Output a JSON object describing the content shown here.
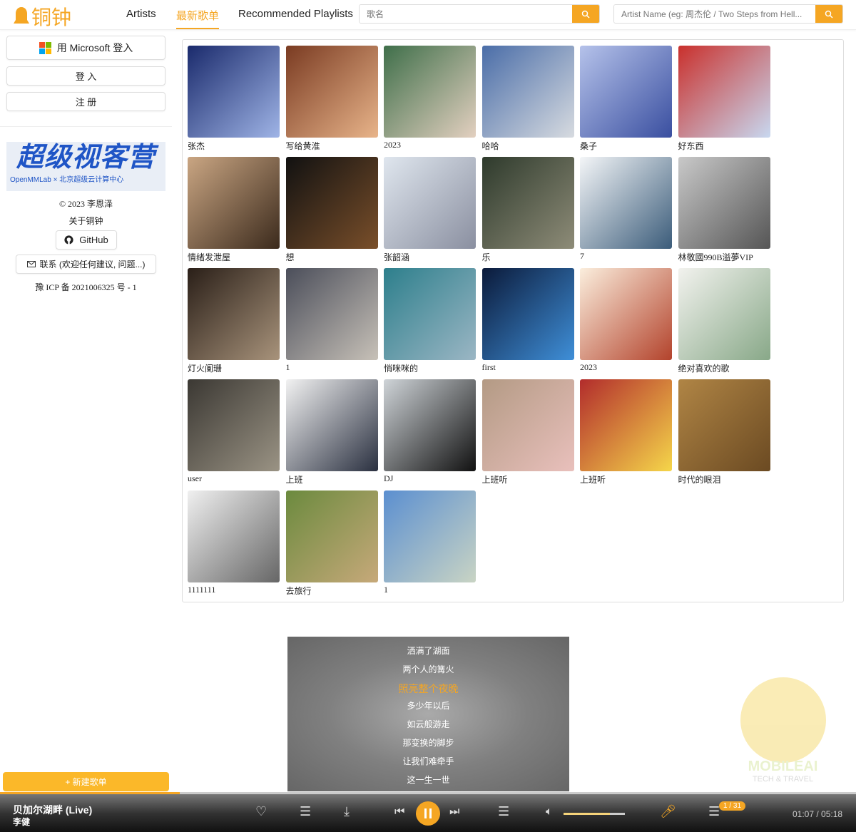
{
  "header": {
    "logo": "铜钟",
    "nav": [
      "Artists",
      "最新歌单",
      "Recommended Playlists"
    ],
    "active_nav": 1,
    "song_search": {
      "placeholder": "歌名",
      "value": ""
    },
    "artist_search": {
      "placeholder": "Artist Name (eg: 周杰伦 / Two Steps from Hell...",
      "value": ""
    }
  },
  "sidebar": {
    "ms_login": "用 Microsoft 登入",
    "login": "登 入",
    "register": "注 册",
    "banner_title": "超级视客营",
    "banner_sub": "OpenMMLab × 北京超级云计算中心",
    "copyright": "© 2023 李恩泽",
    "about": "关于铜钟",
    "github": "GitHub",
    "contact": "联系 (欢迎任何建议, 问题...)",
    "icp": "豫 ICP 备 2021006325 号 - 1",
    "new_playlist": "+ 新建歌单"
  },
  "playlists": [
    {
      "name": "张杰",
      "colors": [
        "#1a2a6c",
        "#9fb4e6"
      ]
    },
    {
      "name": "写给黄淮",
      "colors": [
        "#7a3b22",
        "#e8b48a"
      ]
    },
    {
      "name": "2023",
      "colors": [
        "#3f6f4a",
        "#e3d0c0"
      ]
    },
    {
      "name": "哈哈",
      "colors": [
        "#4a6da8",
        "#d7dbe0"
      ]
    },
    {
      "name": "桑子",
      "colors": [
        "#b5c2ea",
        "#3a4fa0"
      ]
    },
    {
      "name": "好东西",
      "colors": [
        "#c9302c",
        "#c8d8f0"
      ]
    },
    {
      "name": "情绪发泄屋",
      "colors": [
        "#caa683",
        "#3b2a1c"
      ]
    },
    {
      "name": "想",
      "colors": [
        "#111",
        "#7a4f2a"
      ]
    },
    {
      "name": "张韶涵",
      "colors": [
        "#dfe6ee",
        "#8a8fa0"
      ]
    },
    {
      "name": "乐",
      "colors": [
        "#2e3a2c",
        "#8e8c78"
      ]
    },
    {
      "name": "7",
      "colors": [
        "#f4f6f8",
        "#3b5c7a"
      ]
    },
    {
      "name": "林敬國990B溢夢VIP",
      "colors": [
        "#c9c9c9",
        "#555"
      ]
    },
    {
      "name": "灯火阑珊",
      "colors": [
        "#2a1f18",
        "#a8937b"
      ]
    },
    {
      "name": "1",
      "colors": [
        "#4b4e5a",
        "#c7c1b8"
      ]
    },
    {
      "name": "悄咪咪的",
      "colors": [
        "#2d7f8c",
        "#9bb6c4"
      ]
    },
    {
      "name": "first",
      "colors": [
        "#0b1a3a",
        "#3f8fd8"
      ]
    },
    {
      "name": "2023",
      "colors": [
        "#fbeedd",
        "#b3432c"
      ]
    },
    {
      "name": "绝对喜欢的歌",
      "colors": [
        "#f2f2ee",
        "#88a888"
      ]
    },
    {
      "name": "user",
      "colors": [
        "#3b3833",
        "#9a9384"
      ]
    },
    {
      "name": "上班",
      "colors": [
        "#f2f2f2",
        "#2a3040"
      ]
    },
    {
      "name": "DJ",
      "colors": [
        "#cfd4d8",
        "#111"
      ]
    },
    {
      "name": "上班听",
      "colors": [
        "#b39a84",
        "#e9c0bc"
      ]
    },
    {
      "name": "上班听",
      "colors": [
        "#b22c2c",
        "#f5d64a"
      ]
    },
    {
      "name": "时代的眼泪",
      "colors": [
        "#b08545",
        "#6b4a22"
      ]
    },
    {
      "name": "1111111",
      "colors": [
        "#f0f0f0",
        "#666"
      ]
    },
    {
      "name": "去旅行",
      "colors": [
        "#6b8a3e",
        "#c7a97a"
      ]
    },
    {
      "name": "1",
      "colors": [
        "#5b8fd0",
        "#c9d4c4"
      ]
    }
  ],
  "lyrics": {
    "lines": [
      "洒满了湖面",
      "两个人的篝火",
      "照亮整个夜晚",
      "多少年以后",
      "如云般游走",
      "那变换的脚步",
      "让我们难牵手",
      "这一生一世"
    ],
    "current": 2
  },
  "player": {
    "title": "贝加尔湖畔 (Live)",
    "artist": "李健",
    "time": "01:07 / 05:18",
    "progress": 0.21,
    "volume": 0.75,
    "queue_badge": "1 / 31",
    "accent": "#f5a623"
  },
  "watermark": {
    "line1": "MOBILEAI",
    "line2": "TECH & TRAVEL"
  }
}
